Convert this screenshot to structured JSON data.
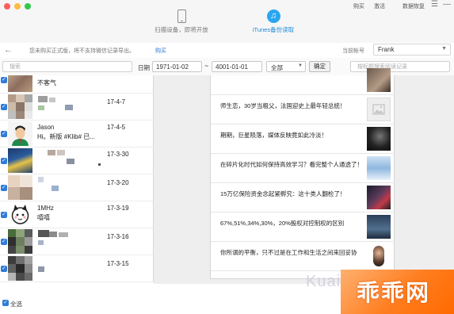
{
  "top_links": [
    "购买",
    "激活",
    "数据恢复"
  ],
  "window_controls": [
    "☰",
    "—"
  ],
  "modes": [
    {
      "label": "扫描设备，即将开放",
      "icon": "phone-icon",
      "active": false
    },
    {
      "label": "iTunes备份读取",
      "icon": "itunes-icon",
      "active": true
    }
  ],
  "notice": {
    "back_icon": "←",
    "text": "您未购买正式版，将不支持微信记录导出。",
    "buy_link": "购买"
  },
  "account": {
    "label": "当前帐号",
    "value": "Frank",
    "arrow": "▼"
  },
  "filter": {
    "search_placeholder": "搜索",
    "date_label": "日期",
    "date_from": "1971-01-02",
    "tilde": "~",
    "date_to": "4001-01-01",
    "type_value": "全部",
    "type_arrow": "▼",
    "ok_label": "确定",
    "article_search_placeholder": "按标题搜索阅读记录"
  },
  "checkmark": "✓",
  "contacts": [
    {
      "name": "",
      "message": "不客气",
      "date": ""
    },
    {
      "name": "",
      "message": "",
      "date": "17-4-7"
    },
    {
      "name": "Jason",
      "message": "Hi。新版 #Klib# 已...",
      "date": "17-4-5"
    },
    {
      "name": "",
      "message": "",
      "date": "17-3-30"
    },
    {
      "name": "",
      "message": "",
      "date": "17-3-20"
    },
    {
      "name": "1MHz",
      "message": "嘻嘻",
      "date": "17-3-19"
    },
    {
      "name": "",
      "message": "",
      "date": "17-3-16"
    },
    {
      "name": "",
      "message": "",
      "date": "17-3-15"
    }
  ],
  "articles": [
    {
      "title": ""
    },
    {
      "title": "师生恋，30岁当粗父，法国迎史上最年轻总统！"
    },
    {
      "title": "期期，巨星陨落，媒体反映竟如此冷淡！"
    },
    {
      "title": "在碎片化时代如何保持高效学习？看完整个人通透了！"
    },
    {
      "title": "15万亿保险资金念起紧孵究：这十类人翻检了！"
    },
    {
      "title": "67%,51%,34%,30%，20%股权对控制权的区别"
    },
    {
      "title": "你所谓的平衡，只不过是在工作和生活之间来回妥协"
    }
  ],
  "select_all_label": "全选",
  "watermark": "Kuai",
  "site_mark": "乖乖网",
  "colors": {
    "accent": "#2f7bd9",
    "link": "#2a79d6",
    "active_tab": "#1a8ad8",
    "site_mark": "#ff7d1e"
  }
}
